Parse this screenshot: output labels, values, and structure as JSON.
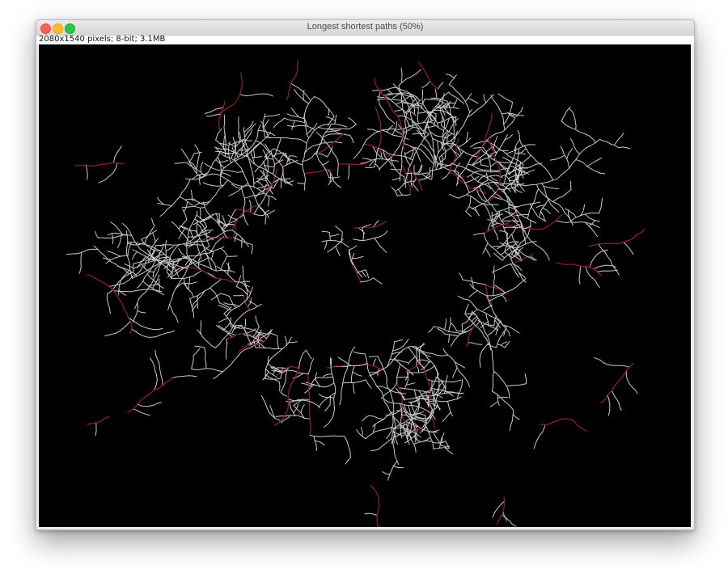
{
  "window": {
    "title": "Longest shortest paths (50%)",
    "info": "2080x1540 pixels; 8-bit; 3.1MB"
  },
  "colors": {
    "background": "#000000",
    "branch": "#c8c8c8",
    "longest_path": "#8a1a3e"
  }
}
